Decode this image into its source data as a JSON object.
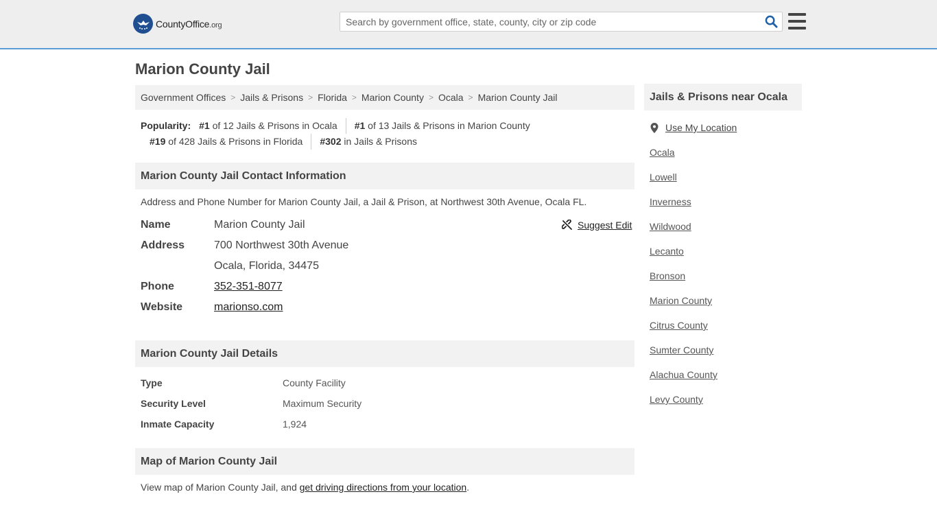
{
  "header": {
    "logo_main": "CountyOffice",
    "logo_tld": ".org",
    "search_placeholder": "Search by government office, state, county, city or zip code",
    "search_icon": "search-icon",
    "menu_icon": "hamburger-menu-icon"
  },
  "page": {
    "title": "Marion County Jail"
  },
  "breadcrumb": {
    "items": [
      "Government Offices",
      "Jails & Prisons",
      "Florida",
      "Marion County",
      "Ocala"
    ],
    "current": "Marion County Jail",
    "separator": ">"
  },
  "popularity": {
    "label": "Popularity:",
    "ranks": [
      {
        "rank": "#1",
        "text": " of 12 Jails & Prisons in Ocala"
      },
      {
        "rank": "#1",
        "text": " of 13 Jails & Prisons in Marion County"
      },
      {
        "rank": "#19",
        "text": " of 428 Jails & Prisons in Florida"
      },
      {
        "rank": "#302",
        "text": " in Jails & Prisons"
      }
    ]
  },
  "contact": {
    "heading": "Marion County Jail Contact Information",
    "description": "Address and Phone Number for Marion County Jail, a Jail & Prison, at Northwest 30th Avenue, Ocala FL.",
    "suggest_edit": "Suggest Edit",
    "name_label": "Name",
    "name_value": "Marion County Jail",
    "address_label": "Address",
    "address_line1": "700 Northwest 30th Avenue",
    "address_line2": "Ocala, Florida, 34475",
    "phone_label": "Phone",
    "phone_value": "352-351-8077",
    "website_label": "Website",
    "website_value": "marionso.com"
  },
  "details": {
    "heading": "Marion County Jail Details",
    "rows": [
      {
        "label": "Type",
        "value": "County Facility"
      },
      {
        "label": "Security Level",
        "value": "Maximum Security"
      },
      {
        "label": "Inmate Capacity",
        "value": "1,924"
      }
    ]
  },
  "map": {
    "heading": "Map of Marion County Jail",
    "text_before": "View map of Marion County Jail, and ",
    "link": "get driving directions from your location",
    "text_after": "."
  },
  "sidebar": {
    "heading": "Jails & Prisons near Ocala",
    "use_location": "Use My Location",
    "places": [
      "Ocala",
      "Lowell",
      "Inverness",
      "Wildwood",
      "Lecanto",
      "Bronson",
      "Marion County",
      "Citrus County",
      "Sumter County",
      "Alachua County",
      "Levy County"
    ]
  },
  "colors": {
    "header_bg": "#eeeeee",
    "header_border": "#5b9bd5",
    "logo_blue": "#1f4e91",
    "search_icon_blue": "#1f5fa8",
    "section_bg": "#f2f2f2"
  }
}
